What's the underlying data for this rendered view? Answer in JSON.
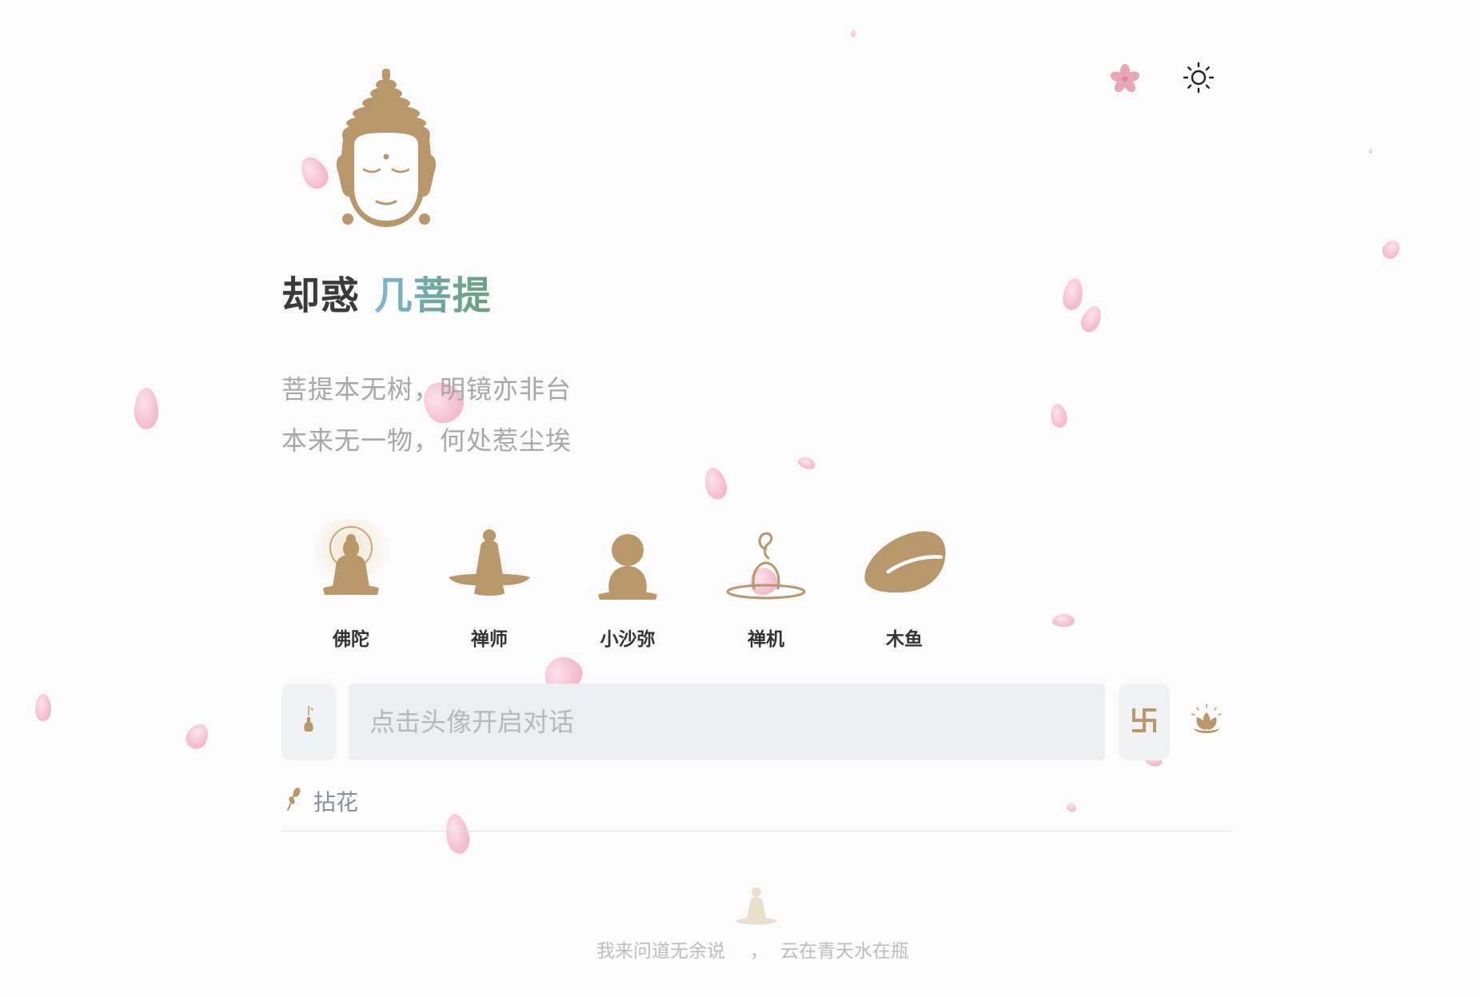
{
  "header": {
    "title_part1": "却惑",
    "title_part2": "几菩提",
    "poem_line1": "菩提本无树，明镜亦非台",
    "poem_line2": "本来无一物，何处惹尘埃"
  },
  "top_icons": {
    "petal_toggle": "sakura-icon",
    "theme_toggle": "sun-icon"
  },
  "characters": [
    {
      "label": "佛陀",
      "icon": "buddha-halo-icon"
    },
    {
      "label": "禅师",
      "icon": "zen-master-icon"
    },
    {
      "label": "小沙弥",
      "icon": "little-monk-icon"
    },
    {
      "label": "禅机",
      "icon": "zen-riddle-icon"
    },
    {
      "label": "木鱼",
      "icon": "wooden-fish-icon"
    }
  ],
  "input": {
    "placeholder": "点击头像开启对话",
    "left_button_icon": "vase-icon",
    "right_button_icon": "swastika-icon",
    "lotus_icon": "lotus-icon"
  },
  "fold": {
    "label": "拈花",
    "icon": "flower-twig-icon"
  },
  "footer": {
    "left": "我来问道无余说",
    "sep": "，",
    "right": "云在青天水在瓶"
  },
  "colors": {
    "accent_gold": "#b8976a",
    "petal_pink": "#f4b9cb",
    "title_gradient_start": "#7fb6d9",
    "title_gradient_end": "#6b9f7e"
  }
}
